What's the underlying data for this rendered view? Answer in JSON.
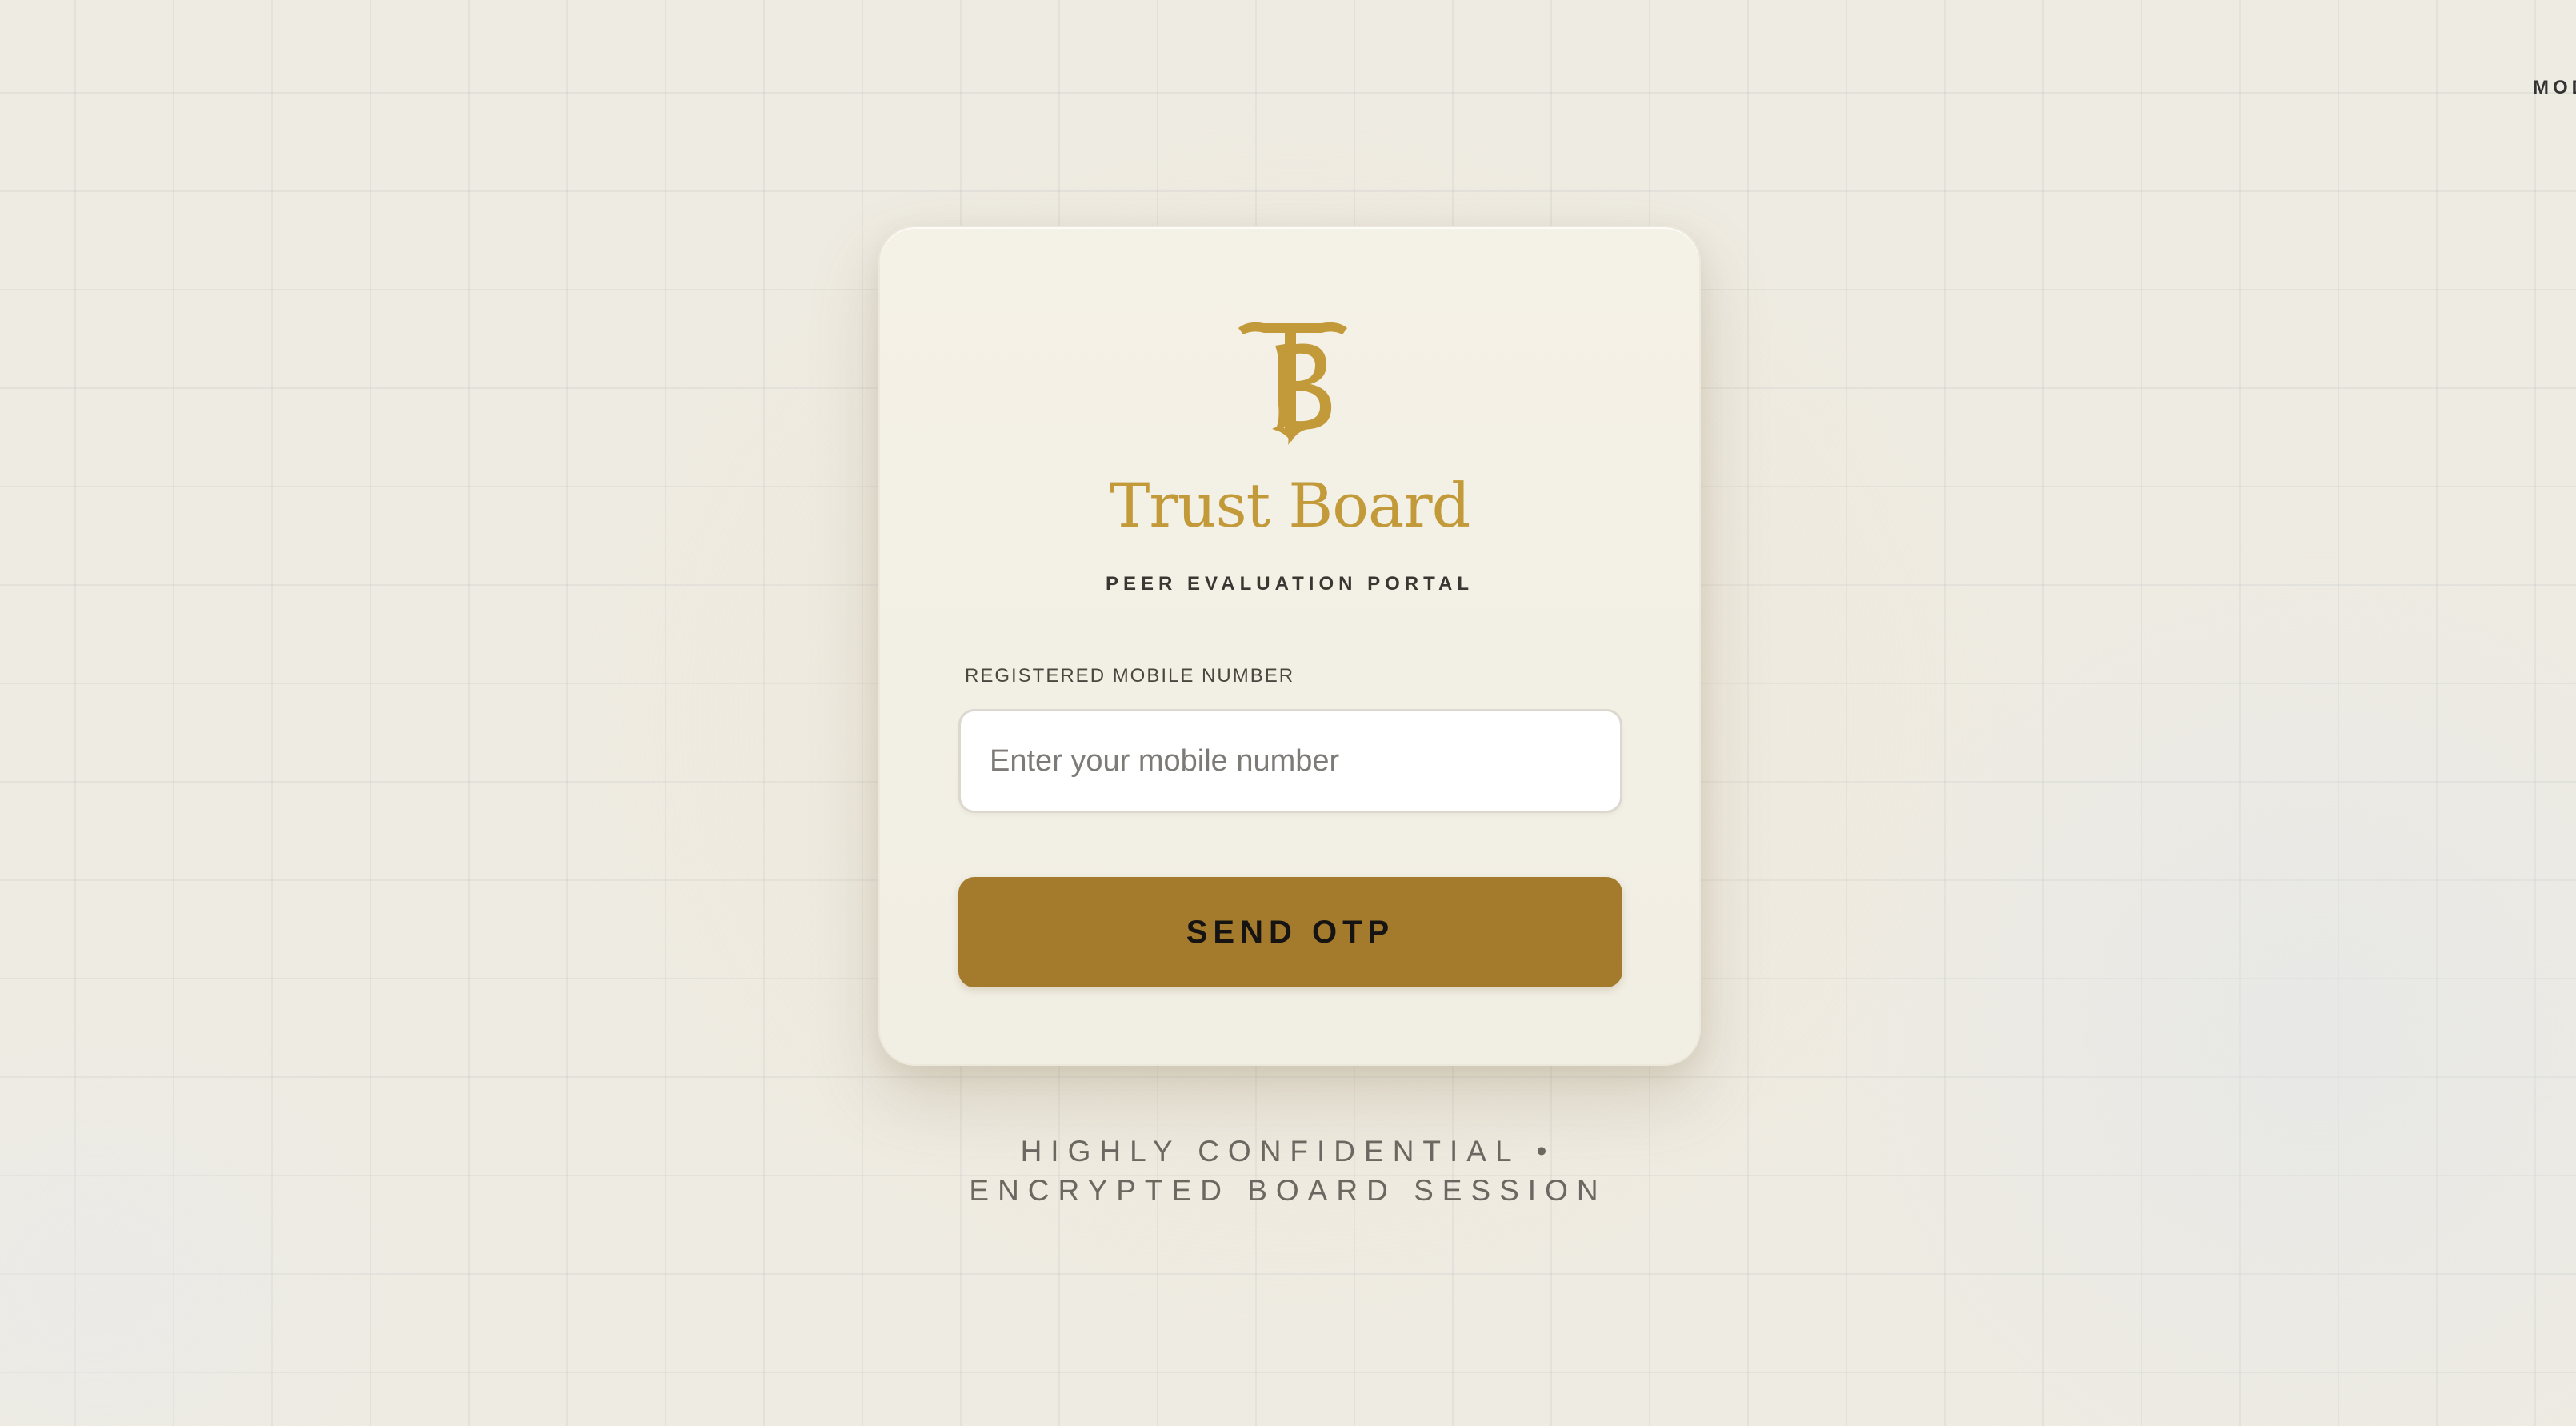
{
  "top_right": {
    "mode_label": "MOD"
  },
  "brand": {
    "logo_icon": "tb-monogram-icon",
    "title": "Trust Board",
    "subtitle": "PEER EVALUATION PORTAL"
  },
  "form": {
    "mobile_label": "REGISTERED MOBILE NUMBER",
    "mobile_value": "",
    "mobile_placeholder": "Enter your mobile number",
    "submit_label": "SEND OTP"
  },
  "footer": {
    "line1": "HIGHLY CONFIDENTIAL •",
    "line2": "ENCRYPTED BOARD SESSION"
  },
  "colors": {
    "accent_gold": "#c39a3a",
    "button_gold": "#a47a2c",
    "card_background": "#f3f0e6",
    "page_background": "#eeebe2"
  }
}
